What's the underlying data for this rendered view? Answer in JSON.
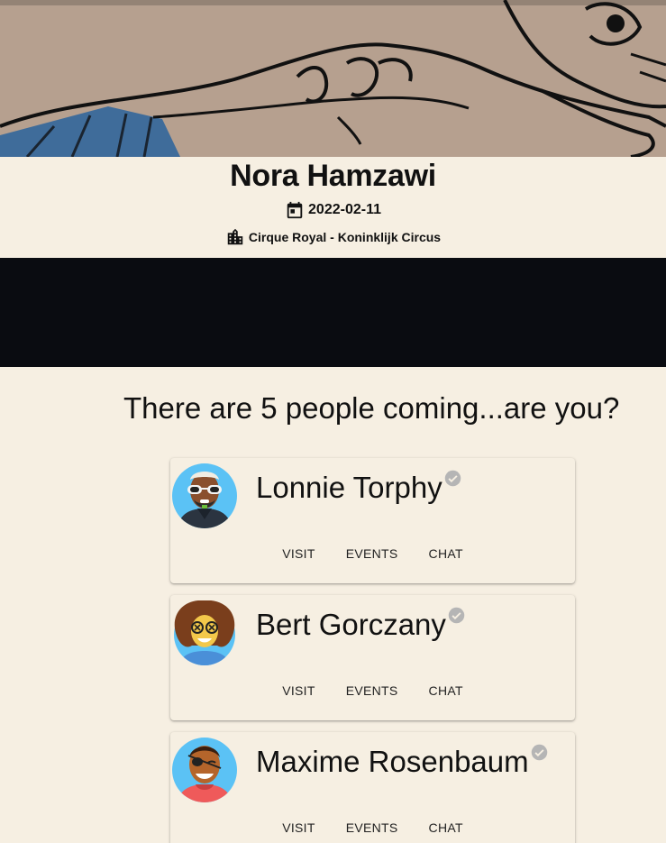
{
  "event": {
    "artist": "Nora Hamzawi",
    "date": "2022-02-11",
    "venue": "Cirque Royal - Koninklijk Circus"
  },
  "attendance_text": "There are 5 people coming...are you?",
  "people": [
    {
      "name": "Lonnie Torphy",
      "avatar": "avatar-sunglasses-icon",
      "verified": true
    },
    {
      "name": "Bert Gorczany",
      "avatar": "avatar-curly-hair-icon",
      "verified": true
    },
    {
      "name": "Maxime Rosenbaum",
      "avatar": "avatar-eyepatch-icon",
      "verified": true
    }
  ],
  "actions": {
    "visit": "VISIT",
    "events": "EVENTS",
    "chat": "CHAT"
  },
  "icons": {
    "date": "calendar-icon",
    "venue": "building-icon",
    "verified": "check-circle-icon"
  },
  "colors": {
    "background": "#f6efe2",
    "dark_band": "#0a0c11",
    "hero": "#b6a08f",
    "avatar_bg": "#5bc2f5",
    "verified": "#b5b5b5"
  }
}
